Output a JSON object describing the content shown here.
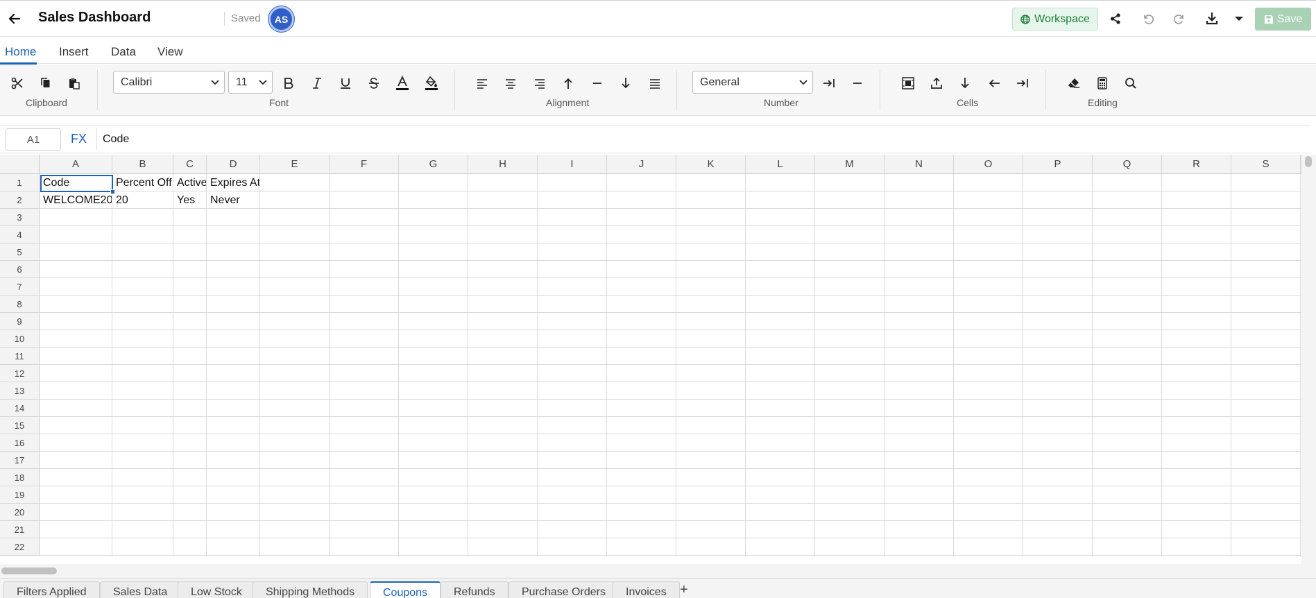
{
  "app": {
    "title": "Sales Dashboard",
    "save_state": "Saved",
    "user_initials": "AS",
    "workspace_label": "Workspace",
    "save_label": "Save"
  },
  "menu_tabs": [
    "Home",
    "Insert",
    "Data",
    "View"
  ],
  "ribbon": {
    "font_name": "Calibri",
    "font_size": "11",
    "number_format": "General",
    "groups": [
      "Clipboard",
      "Font",
      "Alignment",
      "Number",
      "Cells",
      "Editing"
    ]
  },
  "formula_bar": {
    "cell_ref": "A1",
    "fx_label": "FX",
    "value": "Code"
  },
  "grid": {
    "columns": [
      "A",
      "B",
      "C",
      "D",
      "E",
      "F",
      "G",
      "H",
      "I",
      "J",
      "K",
      "L",
      "M",
      "N",
      "O",
      "P",
      "Q",
      "R",
      "S"
    ],
    "rows": [
      "1",
      "2",
      "3",
      "4",
      "5",
      "6",
      "7",
      "8",
      "9",
      "10",
      "11",
      "12",
      "13",
      "14",
      "15",
      "16",
      "17",
      "18",
      "19",
      "20",
      "21",
      "22"
    ],
    "cells": {
      "A1": "Code",
      "B1": "Percent Off",
      "C1": "Active",
      "D1": "Expires At",
      "A2": "WELCOME20",
      "B2": "20",
      "C2": "Yes",
      "D2": "Never"
    }
  },
  "sheet_tabs": [
    "Filters Applied",
    "Sales Data",
    "Low Stock",
    "Shipping Methods",
    "Coupons",
    "Refunds",
    "Purchase Orders",
    "Invoices"
  ],
  "active_sheet": "Coupons",
  "add_sheet_label": "+",
  "colors": {
    "accent": "#1b63b8",
    "workspace_bg": "#e7f6ec",
    "save_bg": "#a9d1b3",
    "avatar_bg": "#2f5fc7"
  }
}
